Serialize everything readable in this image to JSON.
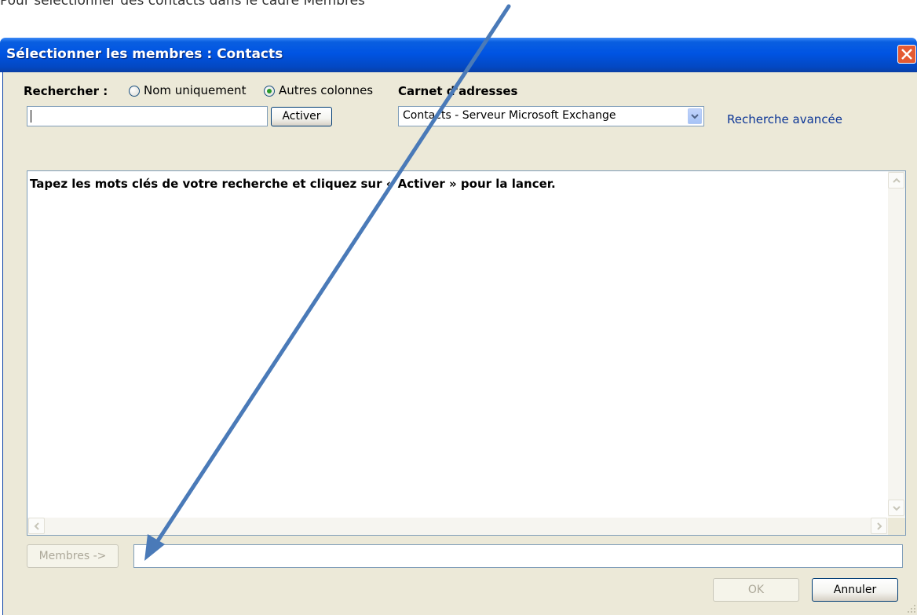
{
  "context_text": "Pour sélectionner des contacts dans le cadre Membres",
  "dialog": {
    "title": "Sélectionner les membres : Contacts",
    "search_label": "Rechercher :",
    "radio_name_only": "Nom uniquement",
    "radio_other_columns": "Autres colonnes",
    "selected_radio": "Autres colonnes",
    "search_value": "",
    "go_button": "Activer",
    "address_book_label": "Carnet d'adresses",
    "address_book_value": "Contacts - Serveur Microsoft Exchange",
    "advanced_search_link": "Recherche avancée",
    "results_hint": "Tapez les mots clés de votre recherche et cliquez sur « Activer » pour la lancer.",
    "members_button": "Membres ->",
    "members_value": "",
    "ok_button": "OK",
    "cancel_button": "Annuler"
  },
  "colors": {
    "title_bar": "#0054e3",
    "dialog_background": "#ece9d8",
    "link": "#0b3596",
    "close_button": "#e45a33",
    "annotation_arrow": "#4a7ab8"
  },
  "icons": [
    "close-icon",
    "chevron-down-icon",
    "scroll-up-icon",
    "scroll-down-icon",
    "scroll-left-icon",
    "scroll-right-icon"
  ]
}
